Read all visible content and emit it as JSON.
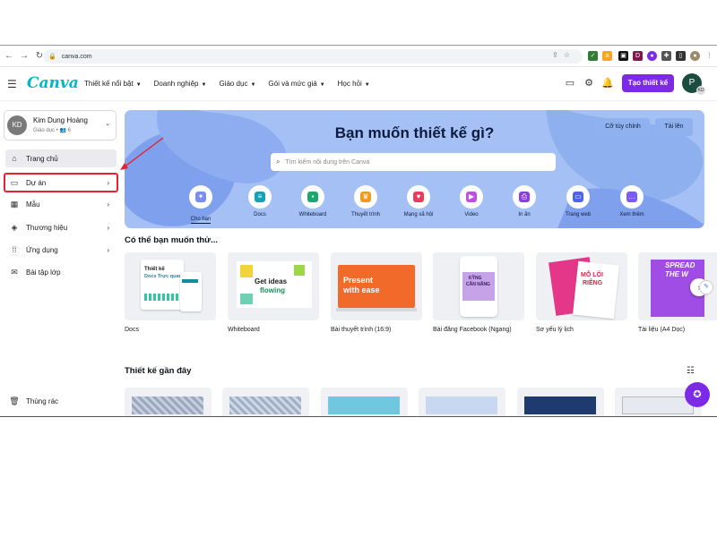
{
  "browser": {
    "url": "canva.com",
    "back_icon": "arrow-left-icon",
    "forward_icon": "arrow-right-icon",
    "reload_icon": "reload-icon"
  },
  "header": {
    "logo": "Canva",
    "nav": [
      "Thiết kế nổi bật",
      "Doanh nghiệp",
      "Giáo dục",
      "Gói và mức giá",
      "Học hỏi"
    ],
    "create_button": "Tạo thiết kế",
    "avatar_initial": "P",
    "avatar_badge": "KD"
  },
  "account": {
    "initials": "KD",
    "name": "Kim Dung Hoàng",
    "sub": "Giáo dục • 👥 6"
  },
  "sidebar": {
    "items": [
      {
        "label": "Trang chủ",
        "icon": "home-icon"
      },
      {
        "label": "Dự án",
        "icon": "folder-icon"
      },
      {
        "label": "Mẫu",
        "icon": "template-icon"
      },
      {
        "label": "Thương hiệu",
        "icon": "brand-icon"
      },
      {
        "label": "Ứng dụng",
        "icon": "apps-grid-icon"
      },
      {
        "label": "Bài tập lớp",
        "icon": "assignment-icon"
      }
    ],
    "trash": "Thùng rác"
  },
  "hero": {
    "title": "Bạn muốn thiết kế gì?",
    "custom_size": "Cỡ tùy chỉnh",
    "upload": "Tải lên",
    "search_placeholder": "Tìm kiếm nội dung trên Canva",
    "categories": [
      {
        "label": "Cho bạn",
        "color": "#7d8cf5"
      },
      {
        "label": "Docs",
        "color": "#13a3b5"
      },
      {
        "label": "Whiteboard",
        "color": "#1aa86d"
      },
      {
        "label": "Thuyết trình",
        "color": "#f09a1f"
      },
      {
        "label": "Mạng xã hội",
        "color": "#ea3b5a"
      },
      {
        "label": "Video",
        "color": "#c04de6"
      },
      {
        "label": "In ấn",
        "color": "#8b3de2"
      },
      {
        "label": "Trang web",
        "color": "#4d63f0"
      },
      {
        "label": "Xem thêm",
        "color": "#7a5af8"
      }
    ]
  },
  "suggest": {
    "title": "Có thể bạn muốn thử...",
    "cards": [
      {
        "label": "Docs",
        "text1": "Thiết kế",
        "text2": "Docs Trực quan"
      },
      {
        "label": "Whiteboard",
        "text1": "Get ideas",
        "text2": "flowing"
      },
      {
        "label": "Bài thuyết trình (16:9)",
        "text1": "Present",
        "text2": "with ease"
      },
      {
        "label": "Bài đăng Facebook (Ngang)",
        "text1": "KỸNG",
        "text2": "CĂN NĂNG"
      },
      {
        "label": "Sơ yếu lý lịch",
        "text1": "MỖ LỐI",
        "text2": "RIÊNG"
      },
      {
        "label": "Tài liệu (A4 Dọc)",
        "text1": "SPREAD",
        "text2": "THE W"
      }
    ]
  },
  "recent": {
    "title": "Thiết kế gần đây"
  },
  "colors": {
    "brand_purple": "#7d2ae8",
    "hero_blue": "#a5c0f5",
    "highlight_red": "#e8212a"
  }
}
